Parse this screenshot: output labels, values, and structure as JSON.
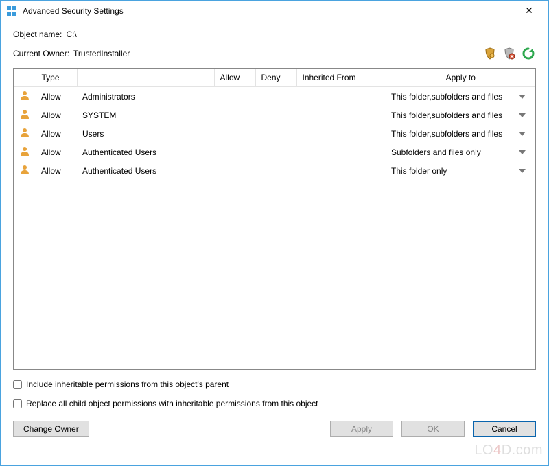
{
  "window": {
    "title": "Advanced Security Settings"
  },
  "object": {
    "label": "Object name:",
    "value": "C:\\"
  },
  "owner": {
    "label": "Current Owner:",
    "value": "TrustedInstaller"
  },
  "columns": {
    "icon": "",
    "type": "Type",
    "name": "",
    "allow": "Allow",
    "deny": "Deny",
    "inherited": "Inherited From",
    "apply": "Apply to"
  },
  "rows": [
    {
      "type": "Allow",
      "name": "Administrators",
      "allow": "",
      "deny": "",
      "inherited": "",
      "apply": "This folder,subfolders and files"
    },
    {
      "type": "Allow",
      "name": "SYSTEM",
      "allow": "",
      "deny": "",
      "inherited": "",
      "apply": "This folder,subfolders and files"
    },
    {
      "type": "Allow",
      "name": "Users",
      "allow": "",
      "deny": "",
      "inherited": "",
      "apply": "This folder,subfolders and files"
    },
    {
      "type": "Allow",
      "name": "Authenticated Users",
      "allow": "",
      "deny": "",
      "inherited": "",
      "apply": "Subfolders and files only"
    },
    {
      "type": "Allow",
      "name": "Authenticated Users",
      "allow": "",
      "deny": "",
      "inherited": "",
      "apply": "This folder only"
    }
  ],
  "checks": {
    "inherit": "Include inheritable permissions from this object's parent",
    "replace": "Replace all child object permissions with inheritable permissions from this object"
  },
  "buttons": {
    "change_owner": "Change Owner",
    "apply": "Apply",
    "ok": "OK",
    "cancel": "Cancel"
  },
  "watermark": {
    "a": "LO",
    "b": "4",
    "c": "D.com"
  }
}
